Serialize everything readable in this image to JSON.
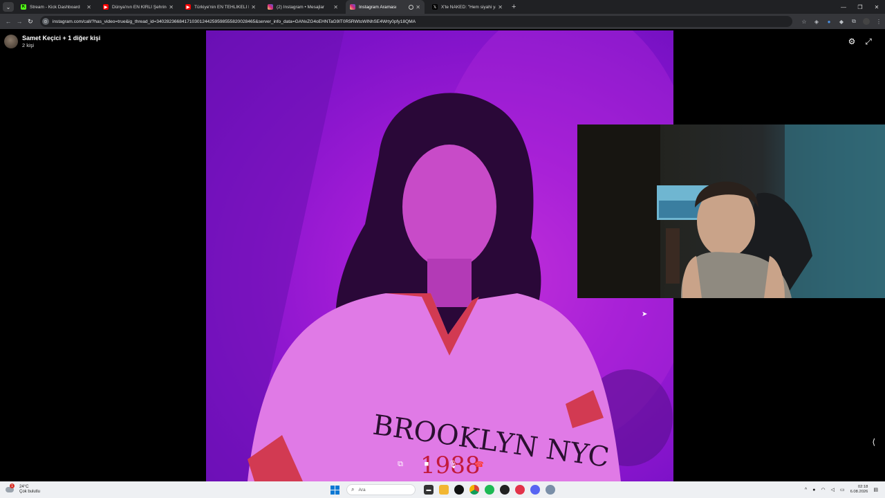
{
  "browser": {
    "tabs": [
      {
        "title": "Stream - Kick Dashboard",
        "favicon": "kick-icon",
        "color": "#53fc18",
        "active": false
      },
      {
        "title": "Dünya'nın EN KİRLİ Şehrine Gi...",
        "favicon": "youtube-icon",
        "color": "#ff0000",
        "active": false
      },
      {
        "title": "Türkiye'nin EN TEHLİKELİ Roma...",
        "favicon": "youtube-icon",
        "color": "#ff0000",
        "active": false
      },
      {
        "title": "(2) Instagram • Mesajlar",
        "favicon": "instagram-icon",
        "color": "#d62976",
        "active": false
      },
      {
        "title": "Instagram Araması",
        "favicon": "instagram-icon",
        "color": "#d62976",
        "active": true
      },
      {
        "title": "X'te NAKED: \"Hem siyahi yahu...",
        "favicon": "x-icon",
        "color": "#000000",
        "active": false
      }
    ],
    "url": "instagram.com/call/?has_video=true&ig_thread_id=340282366841710301244259598555820028465&server_info_data=GANvZG4oEHNTaG9lT0R5RWtoWlNhSE4Wrty0pfy18QMA"
  },
  "call": {
    "participant_name": "Samet Keçici + 1 diğer kişi",
    "participant_count": "2 kişi"
  },
  "taskbar": {
    "weather_temp": "24°C",
    "weather_desc": "Çok bulutlu",
    "search_placeholder": "Ara",
    "time": "02:18",
    "date": "6.08.2026"
  },
  "colors": {
    "main_video_tint": "#a21cd6",
    "end_call": "#ff3b30",
    "chrome_bg": "#202124"
  }
}
